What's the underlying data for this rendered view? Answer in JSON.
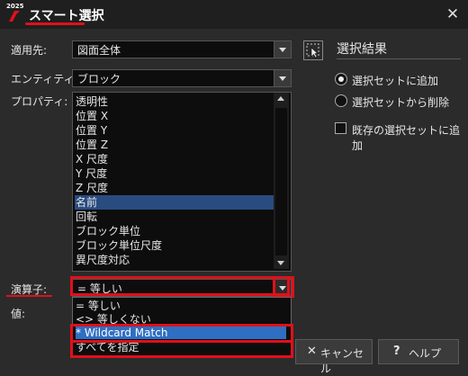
{
  "window": {
    "logo_year": "2025",
    "title": "スマート選択"
  },
  "form": {
    "apply_label": "適用先:",
    "apply_value": "図面全体",
    "entity_label": "エンティティ:",
    "entity_value": "ブロック",
    "property_label": "プロパティ:",
    "properties": [
      "透明性",
      "位置 X",
      "位置 Y",
      "位置 Z",
      "X 尺度",
      "Y 尺度",
      "Z 尺度",
      "名前",
      "回転",
      "ブロック単位",
      "ブロック単位尺度",
      "異尺度対応"
    ],
    "selected_property": "名前",
    "operator_label": "演算子:",
    "operator_value": "= 等しい",
    "value_label": "値:",
    "operator_options": [
      "= 等しい",
      "<> 等しくない",
      "* Wildcard Match",
      "すべてを指定"
    ],
    "selected_operator_option": "* Wildcard Match"
  },
  "result": {
    "title": "選択結果",
    "radio_add": "選択セットに追加",
    "radio_remove": "選択セットから削除",
    "checkbox_existing": "既存の選択セットに追加",
    "selected_radio": "選択セットに追加",
    "checkbox_checked": false
  },
  "buttons": {
    "cancel": "キャンセル",
    "help": "ヘルプ",
    "cancel_icon": "✕",
    "help_icon": "?"
  },
  "colors": {
    "annotation_red": "#e0101a",
    "selection_blue": "#294c80",
    "dropdown_selection_blue": "#2e6fc3"
  }
}
